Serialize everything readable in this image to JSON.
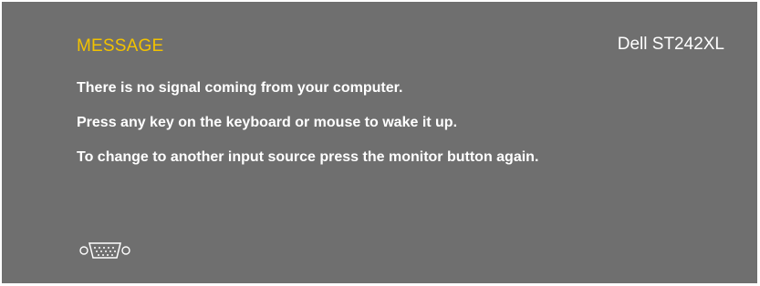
{
  "osd": {
    "title": "MESSAGE",
    "model": "Dell ST242XL",
    "lines": [
      "There is no signal coming from your computer.",
      "Press any key on the keyboard or mouse to wake it up.",
      "To change to another input source press the monitor button again."
    ],
    "input_icon": "vga-connector-icon",
    "colors": {
      "background": "#6f6f6f",
      "title": "#f2c200",
      "text": "#ffffff"
    }
  }
}
